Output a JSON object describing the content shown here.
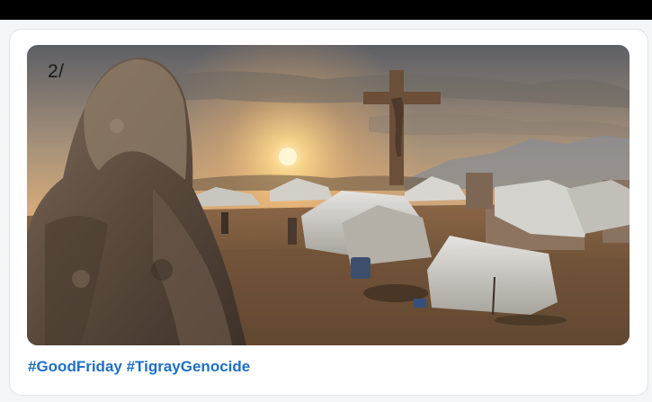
{
  "post": {
    "image_counter": "2/",
    "hashtags": [
      "#GoodFriday",
      "#TigrayGenocide"
    ]
  },
  "colors": {
    "hashtag": "#1d6fc5",
    "card_border": "#e1e4e8",
    "page_background": "#f4f5f6"
  },
  "media": {
    "icon": "photo"
  }
}
